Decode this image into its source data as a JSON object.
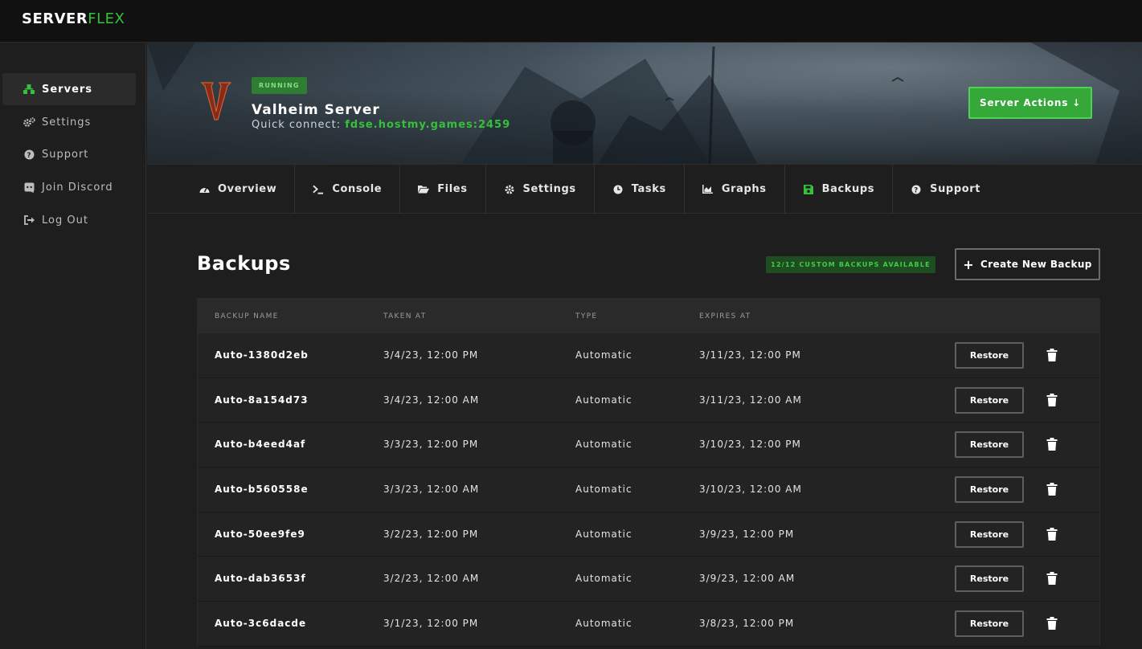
{
  "brand": {
    "logo_part1": "SERVER",
    "logo_part2": "FLEX",
    "accent": "#36c13b"
  },
  "sidebar": {
    "items": [
      {
        "label": "Servers",
        "icon": "servers-icon",
        "active": true
      },
      {
        "label": "Settings",
        "icon": "gears-icon",
        "active": false
      },
      {
        "label": "Support",
        "icon": "question-circle-icon",
        "active": false
      },
      {
        "label": "Join Discord",
        "icon": "discord-icon",
        "active": false
      },
      {
        "label": "Log Out",
        "icon": "logout-icon",
        "active": false
      }
    ]
  },
  "server": {
    "status": "RUNNING",
    "name": "Valheim Server",
    "quick_connect_label": "Quick connect:",
    "quick_connect_address": "fdse.hostmy.games:2459",
    "actions_label": "Server Actions ↓"
  },
  "tabs": [
    {
      "label": "Overview",
      "icon": "dashboard-icon",
      "active": false
    },
    {
      "label": "Console",
      "icon": "terminal-icon",
      "active": false
    },
    {
      "label": "Files",
      "icon": "folder-open-icon",
      "active": false
    },
    {
      "label": "Settings",
      "icon": "gear-icon",
      "active": false
    },
    {
      "label": "Tasks",
      "icon": "clock-icon",
      "active": false
    },
    {
      "label": "Graphs",
      "icon": "area-chart-icon",
      "active": false
    },
    {
      "label": "Backups",
      "icon": "floppy-disk-icon",
      "active": true
    },
    {
      "label": "Support",
      "icon": "question-circle-icon",
      "active": false
    }
  ],
  "backups": {
    "title": "Backups",
    "available_badge": "12/12 CUSTOM BACKUPS AVAILABLE",
    "create_label": "Create New Backup",
    "columns": [
      "BACKUP NAME",
      "TAKEN AT",
      "TYPE",
      "EXPIRES AT"
    ],
    "restore_label": "Restore",
    "rows": [
      {
        "name": "Auto-1380d2eb",
        "taken_at": "3/4/23, 12:00 PM",
        "type": "Automatic",
        "expires_at": "3/11/23, 12:00 PM"
      },
      {
        "name": "Auto-8a154d73",
        "taken_at": "3/4/23, 12:00 AM",
        "type": "Automatic",
        "expires_at": "3/11/23, 12:00 AM"
      },
      {
        "name": "Auto-b4eed4af",
        "taken_at": "3/3/23, 12:00 PM",
        "type": "Automatic",
        "expires_at": "3/10/23, 12:00 PM"
      },
      {
        "name": "Auto-b560558e",
        "taken_at": "3/3/23, 12:00 AM",
        "type": "Automatic",
        "expires_at": "3/10/23, 12:00 AM"
      },
      {
        "name": "Auto-50ee9fe9",
        "taken_at": "3/2/23, 12:00 PM",
        "type": "Automatic",
        "expires_at": "3/9/23, 12:00 PM"
      },
      {
        "name": "Auto-dab3653f",
        "taken_at": "3/2/23, 12:00 AM",
        "type": "Automatic",
        "expires_at": "3/9/23, 12:00 AM"
      },
      {
        "name": "Auto-3c6dacde",
        "taken_at": "3/1/23, 12:00 PM",
        "type": "Automatic",
        "expires_at": "3/8/23, 12:00 PM"
      }
    ]
  }
}
